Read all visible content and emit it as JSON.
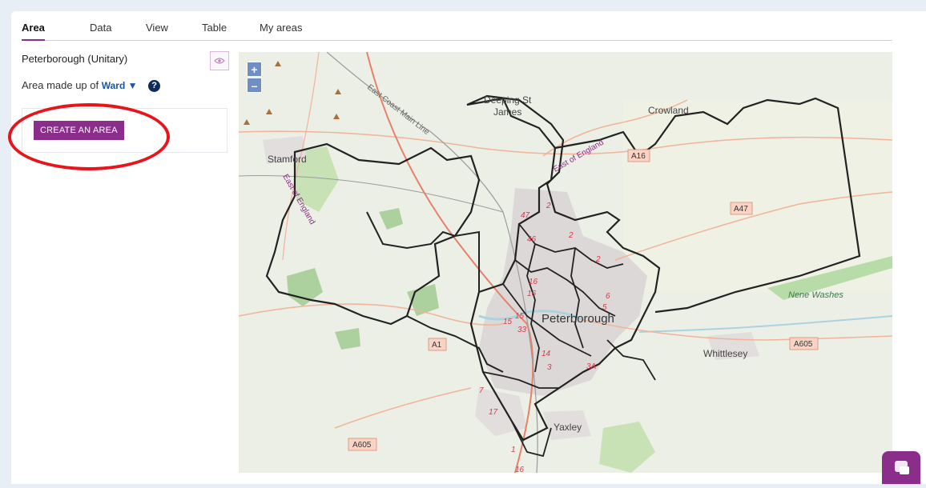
{
  "tabs": [
    {
      "label": "Area",
      "active": true
    },
    {
      "label": "Data",
      "active": false
    },
    {
      "label": "View",
      "active": false
    },
    {
      "label": "Table",
      "active": false
    },
    {
      "label": "My areas",
      "active": false
    }
  ],
  "sidebar": {
    "area_title": "Peterborough (Unitary)",
    "made_up_prefix": "Area made up of",
    "unit_type": "Ward",
    "unit_caret": "▼",
    "help_glyph": "?",
    "create_button": "CREATE AN AREA"
  },
  "map": {
    "zoom_in": "+",
    "zoom_out": "–",
    "places": {
      "deeping_1": "Deeping St",
      "deeping_2": "James",
      "crowland": "Crowland",
      "stamford": "Stamford",
      "peterborough": "Peterborough",
      "whittlesey": "Whittlesey",
      "yaxley": "Yaxley",
      "nene_washes": "Nene Washes",
      "east_coast_main_line": "East Coast Main Line",
      "east_of_england_1": "East of England",
      "east_of_england_2": "East of England"
    },
    "road_labels": {
      "a16": "A16",
      "a47": "A47",
      "a1": "A1",
      "a605_east": "A605",
      "a605_west": "A605"
    },
    "ward_numbers": {
      "n47": "47",
      "n46": "46",
      "n2a": "2",
      "n2b": "2",
      "n2c": "2",
      "n15": "15",
      "n15b": "15",
      "n33": "33",
      "n16": "16",
      "n16b": "16",
      "n6": "6",
      "n5": "5",
      "n34": "3A",
      "n3": "3",
      "n7": "7",
      "n17": "17",
      "n14": "14",
      "n16c": "16",
      "n1": "1"
    }
  },
  "colors": {
    "accent": "#8b2d8b",
    "highlight": "#e8141b",
    "map_background": "#ecefe6",
    "road": "#f1a07f",
    "boundary": "#222222",
    "urban": "#d9d4d4",
    "woodland": "#add19e",
    "water": "#aad3df",
    "ward_number": "#d23d4b"
  }
}
